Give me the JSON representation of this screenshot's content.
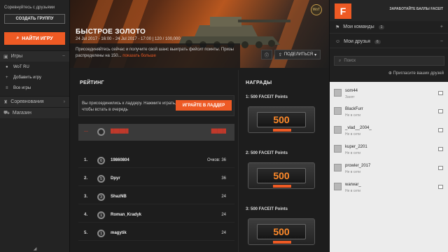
{
  "left": {
    "caption": "Соревнуйтесь с друзьями",
    "create_group": "СОЗДАТЬ ГРУППУ",
    "find_game": "НАЙТИ ИГРУ",
    "games_section": "Игры",
    "games": [
      {
        "label": "WoT RU",
        "icon": "game-icon"
      },
      {
        "label": "Добавить игру",
        "icon": "plus-icon"
      },
      {
        "label": "Все игры",
        "icon": "list-icon"
      }
    ],
    "competitions": "Соревнования",
    "shop": "Магазин"
  },
  "banner": {
    "title": "БЫСТРОЕ ЗОЛОТО",
    "dates": "24 Jul 2017 - 16:00 - 24 Jul 2017 - 17:00 | 120 / 100,000",
    "description": "Присоединяйтесь сейчас и получите свой шанс выиграть фейсит поинты. Призы распределены на 150...",
    "more": "показать больше",
    "share": "ПОДЕЛИТЬСЯ"
  },
  "rating": {
    "heading": "РЕЙТИНГ",
    "join_text": "Вы присоединились к ладдеру. Нажмите играть, чтобы встать в очередь",
    "join_button": "ИГРАЙТЕ В ЛАДДЕР",
    "me": {
      "pos": "—",
      "name": "██████",
      "score": "█████"
    },
    "rows": [
      {
        "pos": "1.",
        "name": "19860804",
        "score": "Очков: 36",
        "lvl": "6"
      },
      {
        "pos": "2.",
        "name": "Dpyr",
        "score": "36",
        "lvl": "5"
      },
      {
        "pos": "3.",
        "name": "ShazNB",
        "score": "24",
        "lvl": "3"
      },
      {
        "pos": "4.",
        "name": "Roman_Kradyk",
        "score": "24",
        "lvl": "1"
      },
      {
        "pos": "5.",
        "name": "magytik",
        "score": "24",
        "lvl": "1"
      }
    ]
  },
  "prizes": {
    "heading": "НАГРАДЫ",
    "items": [
      {
        "label": "1: 500 FACEIT Points",
        "value": "500"
      },
      {
        "label": "2: 500 FACEIT Points",
        "value": "500"
      },
      {
        "label": "3: 500 FACEIT Points",
        "value": "500"
      }
    ]
  },
  "right": {
    "earn": "ЗАРАБОТАЙТЕ БАЛЛЫ FACEIT",
    "teams": {
      "label": "Мои команды",
      "count": "1"
    },
    "friends": {
      "label": "Мои друзья",
      "count": "6"
    },
    "search_placeholder": "Поиск",
    "invite": "Пригласите ваших друзей",
    "list": [
      {
        "name": "som44",
        "status": "Занят"
      },
      {
        "name": "BlackFurr",
        "status": "Не в сети"
      },
      {
        "name": "_vlad__2004_",
        "status": "Не в сети"
      },
      {
        "name": "kuper_2201",
        "status": "Не в сети"
      },
      {
        "name": "prowler_2017",
        "status": "Не в сети"
      },
      {
        "name": "warwar_",
        "status": "Не в сети"
      }
    ]
  },
  "colors": {
    "accent": "#ee5a24",
    "panel": "#232323"
  }
}
